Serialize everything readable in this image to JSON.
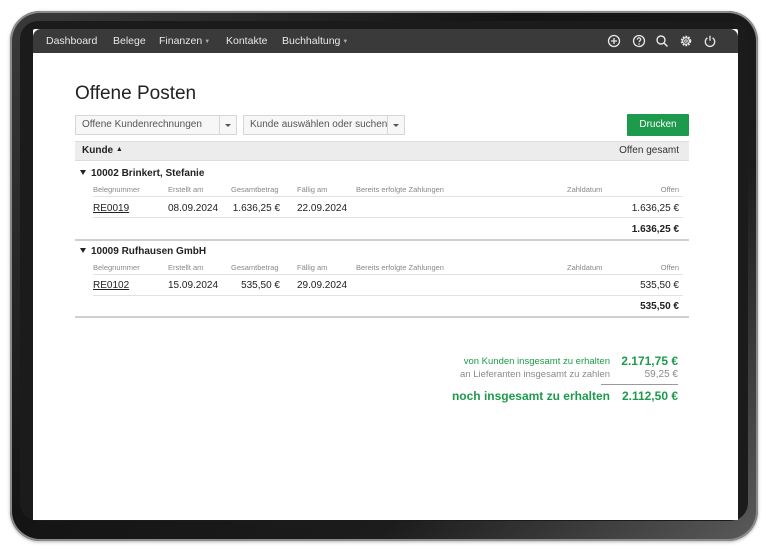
{
  "nav": {
    "items": [
      {
        "label": "Dashboard",
        "dropdown": false
      },
      {
        "label": "Belege",
        "dropdown": false
      },
      {
        "label": "Finanzen",
        "dropdown": true
      },
      {
        "label": "Kontakte",
        "dropdown": false
      },
      {
        "label": "Buchhaltung",
        "dropdown": true
      }
    ],
    "icons": [
      "plus-circle-icon",
      "help-circle-icon",
      "search-icon",
      "gear-icon",
      "power-icon"
    ]
  },
  "page": {
    "title": "Offene Posten",
    "filter_type": "Offene Kundenrechnungen",
    "customer_select_placeholder": "Kunde auswählen oder suchen",
    "print_label": "Drucken"
  },
  "table": {
    "col_customer": "Kunde",
    "col_open_total": "Offen gesamt",
    "subheaders": {
      "doc": "Belegnummer",
      "created": "Erstellt am",
      "total": "Gesamtbetrag",
      "due": "Fällig am",
      "payments": "Bereits erfolgte Zahlungen",
      "paydate": "Zahldatum",
      "open": "Offen"
    },
    "groups": [
      {
        "title": "10002 Brinkert, Stefanie",
        "rows": [
          {
            "doc": "RE0019",
            "created": "08.09.2024",
            "total": "1.636,25 €",
            "due": "22.09.2024",
            "payments": "",
            "paydate": "",
            "open": "1.636,25 €"
          }
        ],
        "sum": "1.636,25 €"
      },
      {
        "title": "10009 Rufhausen GmbH",
        "rows": [
          {
            "doc": "RE0102",
            "created": "15.09.2024",
            "total": "535,50 €",
            "due": "29.09.2024",
            "payments": "",
            "paydate": "",
            "open": "535,50 €"
          }
        ],
        "sum": "535,50 €"
      }
    ]
  },
  "summary": {
    "receivable_label": "von Kunden insgesamt zu erhalten",
    "receivable_value": "2.171,75 €",
    "payable_label": "an Lieferanten insgesamt zu zahlen",
    "payable_value": "59,25 €",
    "net_label": "noch insgesamt zu erhalten",
    "net_value": "2.112,50 €"
  },
  "colors": {
    "accent": "#1e9a4c",
    "navbar": "#3a3a3a"
  }
}
